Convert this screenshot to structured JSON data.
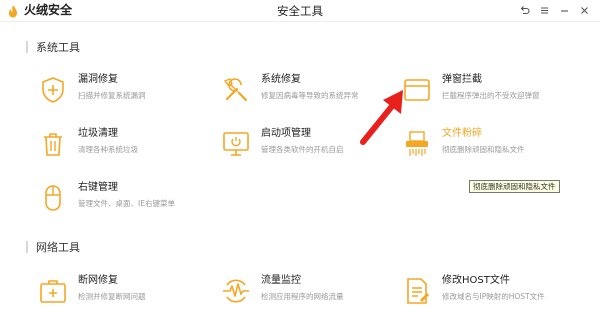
{
  "app": {
    "brand": "火绒安全",
    "window_title": "安全工具",
    "accent": "#f5a623",
    "controls": [
      "back-icon",
      "menu-icon",
      "minimize-icon",
      "close-icon"
    ]
  },
  "sections": {
    "system": {
      "title": "系统工具",
      "items": [
        {
          "title": "漏洞修复",
          "desc": "扫描并修复系统漏洞",
          "icon": "shield-plus-icon"
        },
        {
          "title": "系统修复",
          "desc": "修复因病毒等导致的系统异常",
          "icon": "tools-icon"
        },
        {
          "title": "弹窗拦截",
          "desc": "拦截程序弹出的不受欢迎弹窗",
          "icon": "window-icon"
        },
        {
          "title": "垃圾清理",
          "desc": "清理各种系统垃圾",
          "icon": "trash-icon"
        },
        {
          "title": "启动项管理",
          "desc": "管理各类软件的开机自启",
          "icon": "monitor-power-icon"
        },
        {
          "title": "文件粉碎",
          "desc": "彻底删除顽固和隐私文件",
          "icon": "shredder-icon"
        },
        {
          "title": "右键管理",
          "desc": "管理文件、桌面、IE右键菜单",
          "icon": "mouse-icon"
        }
      ]
    },
    "network": {
      "title": "网络工具",
      "items": [
        {
          "title": "断网修复",
          "desc": "检测并修复断网问题",
          "icon": "medkit-icon"
        },
        {
          "title": "流量监控",
          "desc": "检测应用程序的网络流量",
          "icon": "pulse-icon"
        },
        {
          "title": "修改HOST文件",
          "desc": "修改域名与IP映射的HOST文件",
          "icon": "host-file-icon"
        }
      ]
    }
  },
  "tooltip": "彻底删除顽固和隐私文件"
}
